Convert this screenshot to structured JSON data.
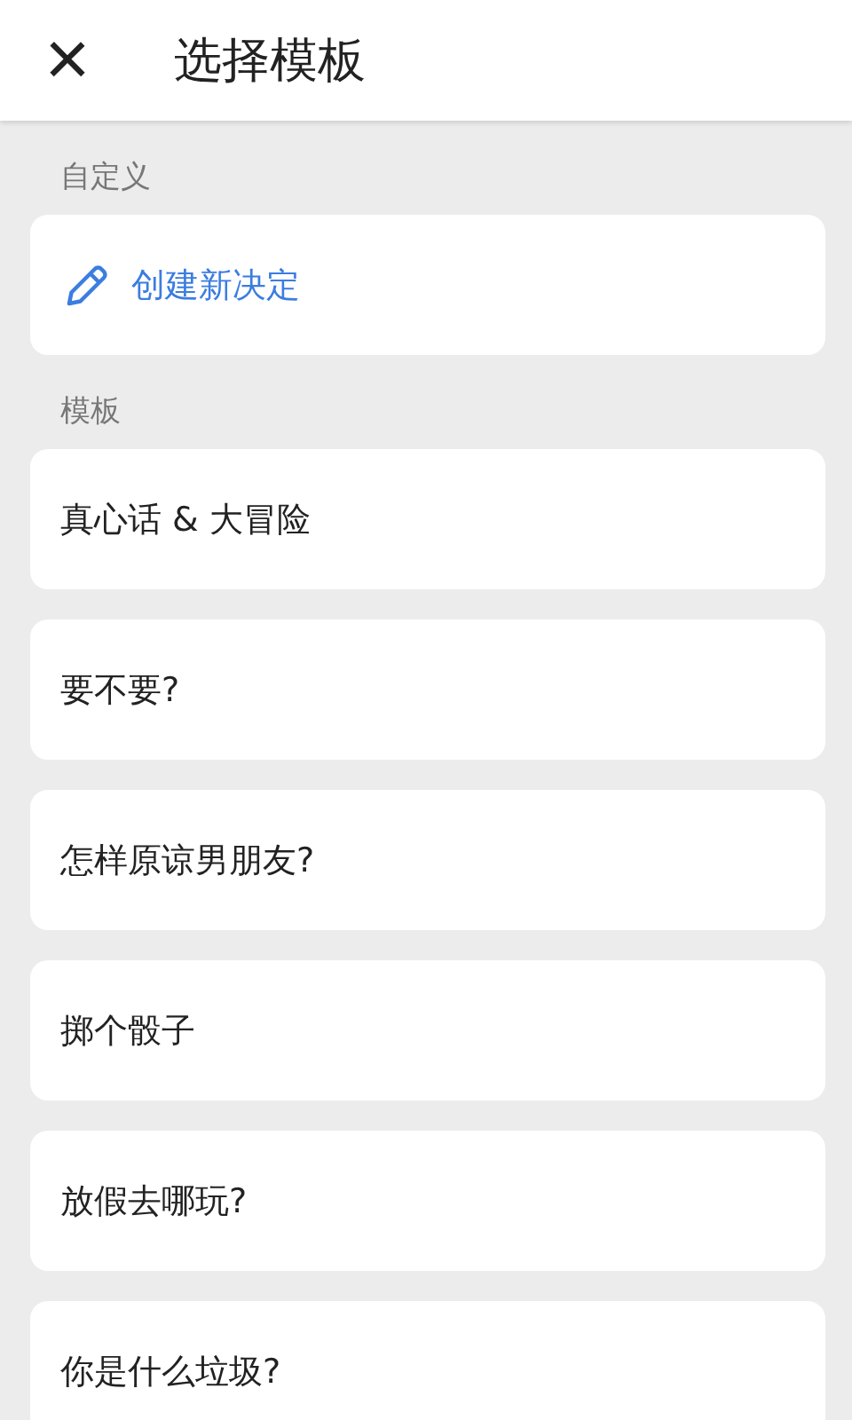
{
  "header": {
    "close": "×",
    "title": "选择模板"
  },
  "custom": {
    "label": "自定义",
    "create": "创建新决定"
  },
  "templates": {
    "label": "模板",
    "items": [
      {
        "title": "真心话 & 大冒险"
      },
      {
        "title": "要不要?"
      },
      {
        "title": "怎样原谅男朋友?"
      },
      {
        "title": "掷个骰子"
      },
      {
        "title": "放假去哪玩?"
      },
      {
        "title": "你是什么垃圾?"
      }
    ]
  }
}
